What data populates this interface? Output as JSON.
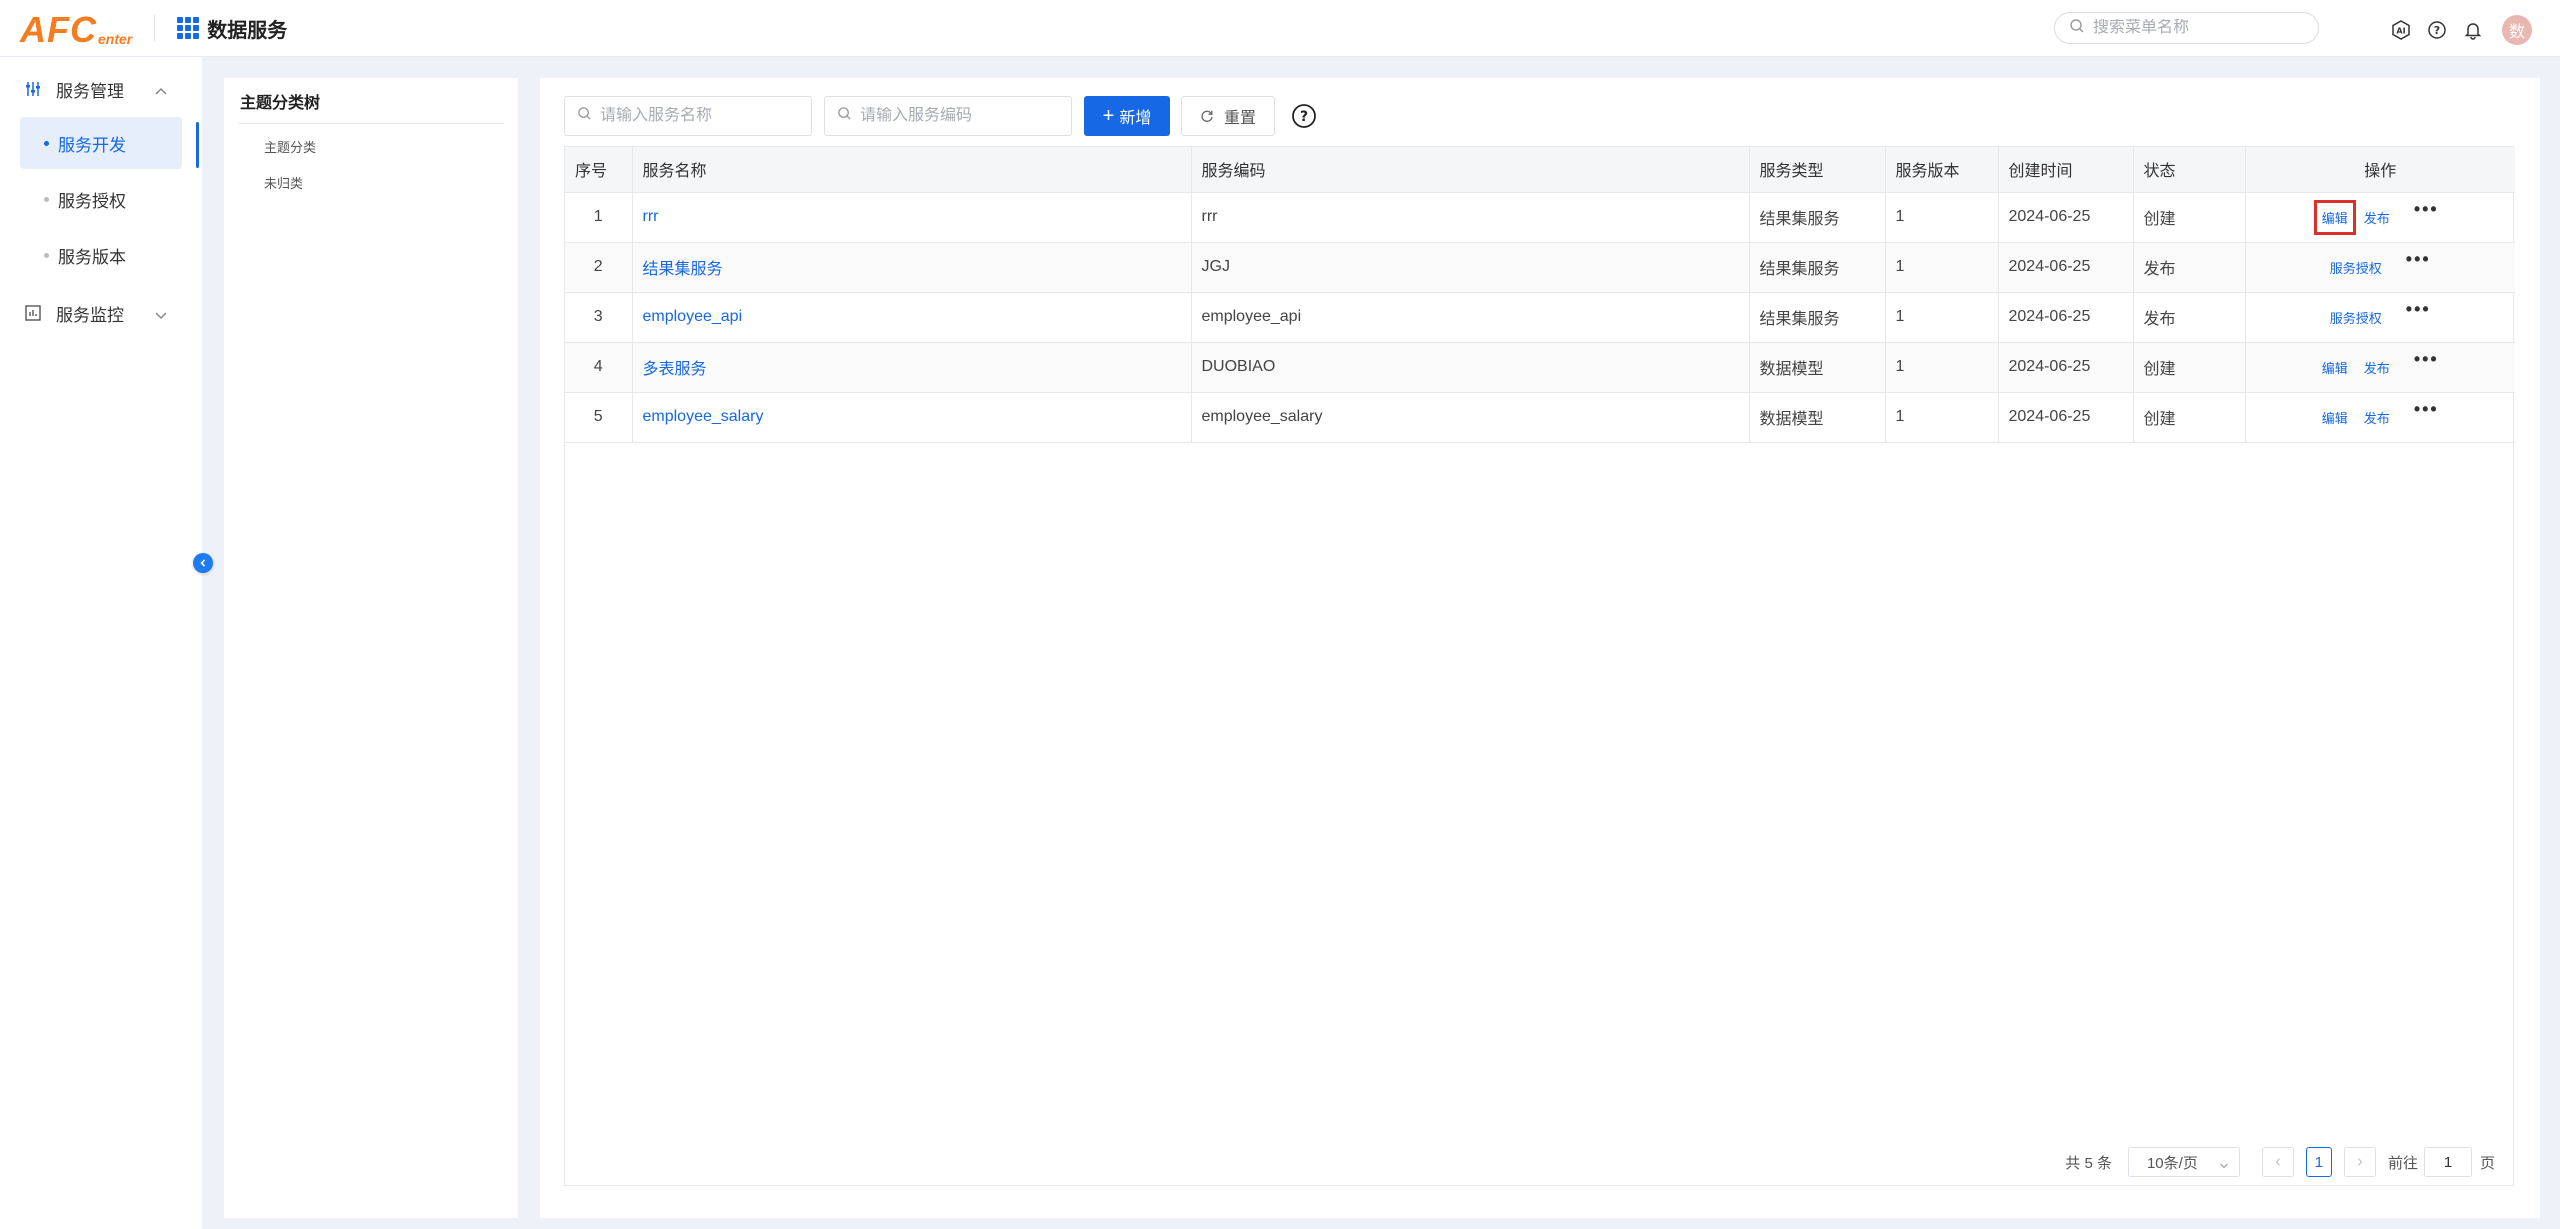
{
  "header": {
    "logo_big": "AFC",
    "logo_small": "enter",
    "app_title": "数据服务",
    "search_placeholder": "搜索菜单名称",
    "avatar_text": "数"
  },
  "sidebar": {
    "groups": [
      {
        "label": "服务管理",
        "icon": "sliders-icon",
        "expanded": true,
        "items": [
          {
            "label": "服务开发",
            "active": true
          },
          {
            "label": "服务授权",
            "active": false
          },
          {
            "label": "服务版本",
            "active": false
          }
        ]
      },
      {
        "label": "服务监控",
        "icon": "chart-box-icon",
        "expanded": false
      }
    ]
  },
  "tree": {
    "title": "主题分类树",
    "nodes": [
      "主题分类",
      "未归类"
    ]
  },
  "toolbar": {
    "name_placeholder": "请输入服务名称",
    "code_placeholder": "请输入服务编码",
    "add_label": "新增",
    "reset_label": "重置"
  },
  "table": {
    "columns": [
      "序号",
      "服务名称",
      "服务编码",
      "服务类型",
      "服务版本",
      "创建时间",
      "状态",
      "操作"
    ],
    "rows": [
      {
        "no": "1",
        "name": "rrr",
        "code": "rrr",
        "type": "结果集服务",
        "version": "1",
        "created": "2024-06-25",
        "status": "创建",
        "ops": [
          "编辑",
          "发布"
        ],
        "more": "•••"
      },
      {
        "no": "2",
        "name": "结果集服务",
        "code": "JGJ",
        "type": "结果集服务",
        "version": "1",
        "created": "2024-06-25",
        "status": "发布",
        "ops": [
          "服务授权"
        ],
        "more": "•••"
      },
      {
        "no": "3",
        "name": "employee_api",
        "code": "employee_api",
        "type": "结果集服务",
        "version": "1",
        "created": "2024-06-25",
        "status": "发布",
        "ops": [
          "服务授权"
        ],
        "more": "•••"
      },
      {
        "no": "4",
        "name": "多表服务",
        "code": "DUOBIAO",
        "type": "数据模型",
        "version": "1",
        "created": "2024-06-25",
        "status": "创建",
        "ops": [
          "编辑",
          "发布"
        ],
        "more": "•••"
      },
      {
        "no": "5",
        "name": "employee_salary",
        "code": "employee_salary",
        "type": "数据模型",
        "version": "1",
        "created": "2024-06-25",
        "status": "创建",
        "ops": [
          "编辑",
          "发布"
        ],
        "more": "•••"
      }
    ]
  },
  "pagination": {
    "total_text": "共 5 条",
    "page_size": "10条/页",
    "current_page": "1",
    "goto_label": "前往",
    "goto_value": "1",
    "page_suffix": "页"
  },
  "colors": {
    "primary": "#1768e4",
    "logo": "#f57c1f",
    "highlight": "#d9302c"
  }
}
